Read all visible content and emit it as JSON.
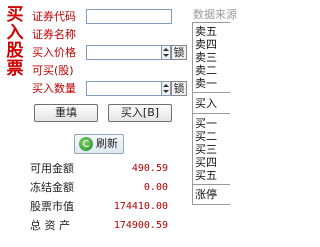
{
  "panel": {
    "title_chars": [
      "买",
      "入",
      "股",
      "票"
    ]
  },
  "form": {
    "code_label": "证券代码",
    "code_value": "",
    "name_label": "证券名称",
    "name_value": "",
    "price_label": "买入价格",
    "price_value": "",
    "lock_label": "锁",
    "available_label": "可买(股)",
    "available_value": "",
    "qty_label": "买入数量",
    "qty_value": "",
    "reset_button": "重填",
    "buy_button": "买入[B]"
  },
  "refresh": {
    "label": "刷新",
    "icon": "refresh-icon"
  },
  "account": {
    "rows": [
      {
        "label": "可用金额",
        "value": "490.59"
      },
      {
        "label": "冻结金额",
        "value": "0.00"
      },
      {
        "label": "股票市值",
        "value": "174410.00"
      },
      {
        "label": "总 资 产",
        "value": "174900.59"
      }
    ]
  },
  "quote": {
    "header": "数据来源",
    "sell_rows": [
      "卖五",
      "卖四",
      "卖三",
      "卖二",
      "卖一"
    ],
    "mid_row": "买入",
    "buy_rows": [
      "买一",
      "买二",
      "买三",
      "买四",
      "买五"
    ],
    "bottom_row": "涨停"
  },
  "colors": {
    "accent_red": "#d40000",
    "value_red": "#b00000"
  }
}
